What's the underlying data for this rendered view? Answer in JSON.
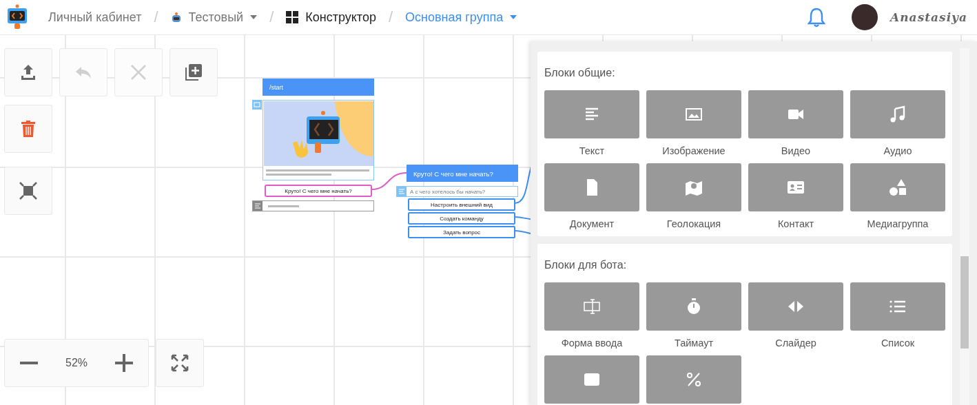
{
  "header": {
    "breadcrumbs": [
      {
        "kind": "link",
        "label": "Личный кабинет"
      },
      {
        "kind": "dropdown",
        "label": "Тестовый"
      },
      {
        "kind": "page",
        "label": "Конструктор"
      },
      {
        "kind": "dropdown-active",
        "label": "Основная группа"
      }
    ],
    "separator": "/",
    "user": {
      "name": "Anastasiya"
    }
  },
  "toolbar": {
    "buttons": [
      {
        "kind": "upload",
        "disabled": false
      },
      {
        "kind": "undo",
        "disabled": true
      },
      {
        "kind": "close",
        "disabled": true
      },
      {
        "kind": "add",
        "disabled": false
      },
      {
        "kind": "trash",
        "disabled": false
      },
      {
        "kind": "fit",
        "disabled": false
      }
    ]
  },
  "zoom": {
    "value": "52%"
  },
  "diagram": {
    "start_node": {
      "title": "/start",
      "button": "Круто! С чего мне начать?"
    },
    "second_node": {
      "title": "Круто! С чего мне начать?",
      "text": "А с чего хотелось бы начать?",
      "buttons": [
        "Настроить внешний вид",
        "Создать команду",
        "Задать вопрос"
      ]
    }
  },
  "blocks_panel": {
    "sections": [
      {
        "title": "Блоки общие:",
        "items": [
          {
            "kind": "text",
            "label": "Текст"
          },
          {
            "kind": "image",
            "label": "Изображение"
          },
          {
            "kind": "video",
            "label": "Видео"
          },
          {
            "kind": "audio",
            "label": "Аудио"
          },
          {
            "kind": "document",
            "label": "Документ"
          },
          {
            "kind": "geo",
            "label": "Геолокация"
          },
          {
            "kind": "contact",
            "label": "Контакт"
          },
          {
            "kind": "media",
            "label": "Медиагруппа"
          }
        ]
      },
      {
        "title": "Блоки для бота:",
        "items": [
          {
            "kind": "input",
            "label": "Форма ввода"
          },
          {
            "kind": "timer",
            "label": "Таймаут"
          },
          {
            "kind": "slider",
            "label": "Слайдер"
          },
          {
            "kind": "list",
            "label": "Список"
          },
          {
            "kind": "card"
          },
          {
            "kind": "percent"
          }
        ]
      }
    ]
  }
}
